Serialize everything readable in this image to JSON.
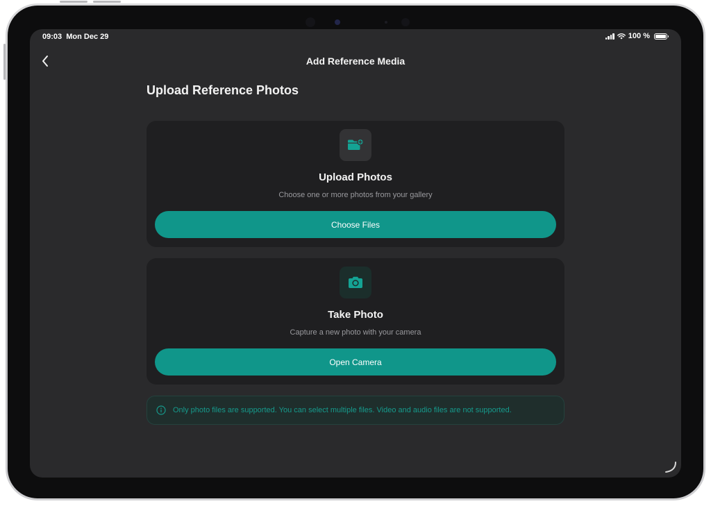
{
  "status_bar": {
    "time": "09:03",
    "date": "Mon Dec 29",
    "battery": "100 %"
  },
  "nav": {
    "title": "Add Reference Media",
    "back_icon": "chevron-left-icon"
  },
  "page_title": "Upload Reference Photos",
  "cards": [
    {
      "icon": "folder-plus-icon",
      "title": "Upload Photos",
      "subtitle": "Choose one or more photos from your gallery",
      "button_label": "Choose Files"
    },
    {
      "icon": "camera-icon",
      "title": "Take Photo",
      "subtitle": "Capture a new photo with your camera",
      "button_label": "Open Camera"
    }
  ],
  "notice": {
    "icon": "info-icon",
    "text": "Only photo files are supported. You can select multiple files. Video and audio files are not supported."
  },
  "colors": {
    "accent": "#10968a",
    "screen_bg": "#2a2a2c",
    "card_bg": "#1f1f21",
    "notice_text": "#169a8c"
  }
}
